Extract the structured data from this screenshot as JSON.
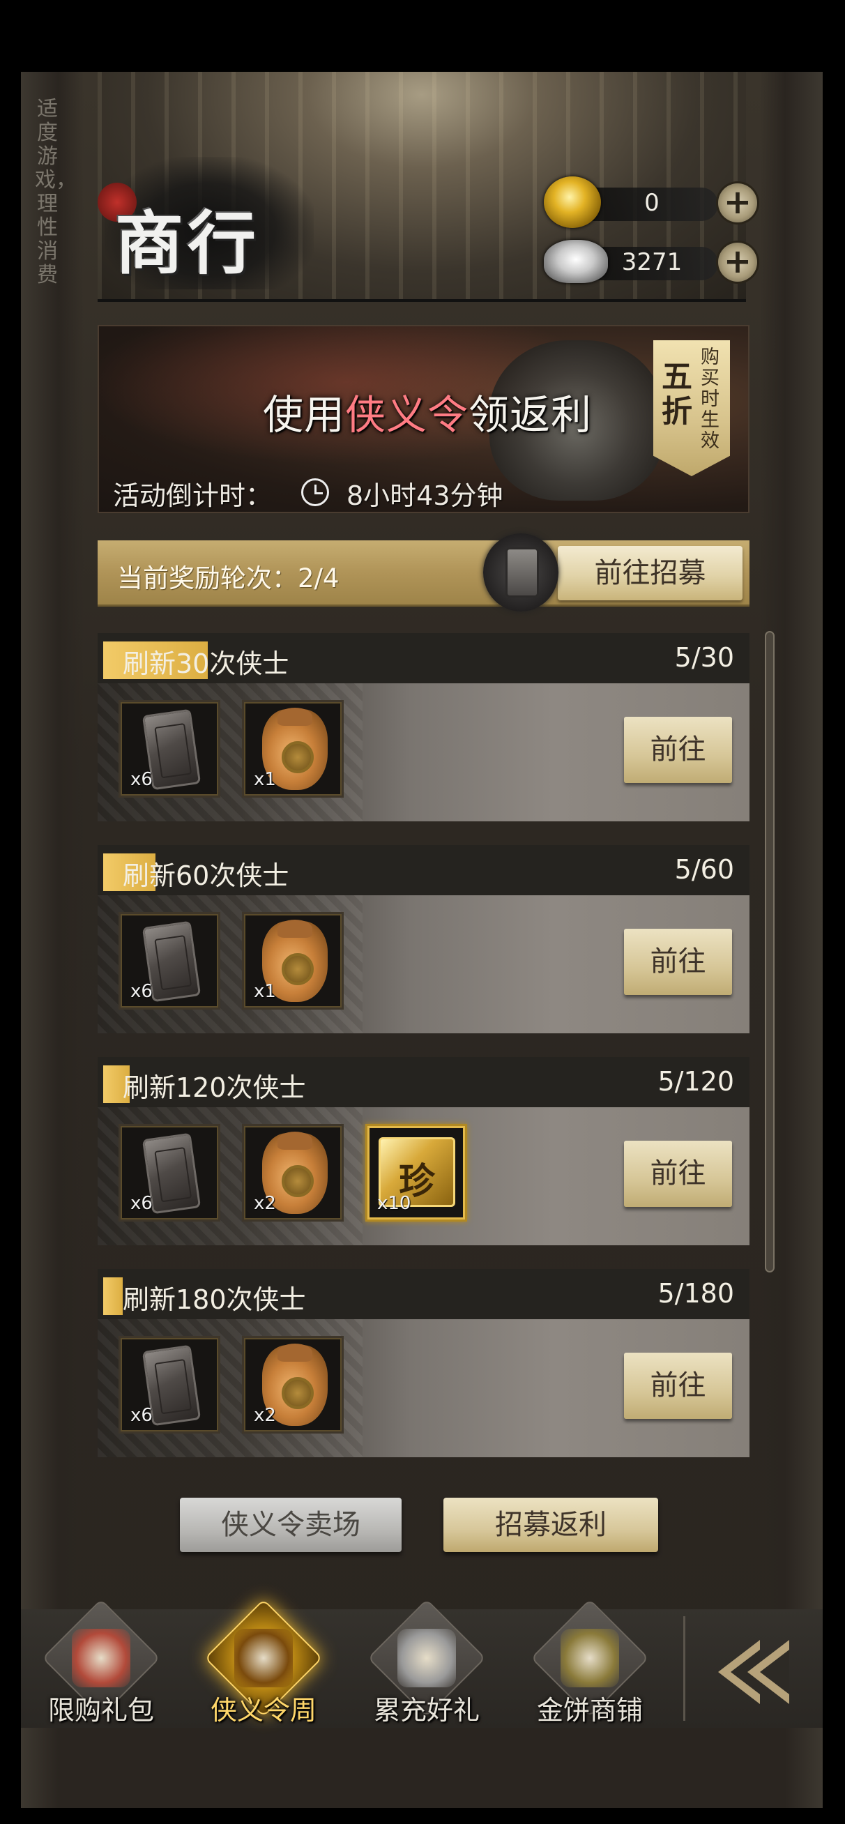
{
  "side_notice": "适度游戏，理性消费",
  "header": {
    "title": "商行",
    "currencies": [
      {
        "icon": "gold-coin-icon",
        "value": "0"
      },
      {
        "icon": "silver-ingot-icon",
        "value": "3271"
      }
    ]
  },
  "banner": {
    "title_pre": "使用",
    "title_highlight": "侠义令",
    "title_post": "领返利",
    "countdown_label": "活动倒计时：",
    "countdown_value": "8小时43分钟",
    "discount_big": "五折",
    "discount_small": "购买时生效"
  },
  "round": {
    "label": "当前奖励轮次：2/4",
    "button": "前往招募"
  },
  "tasks": [
    {
      "title": "刷新30次侠士",
      "progress": "5/30",
      "fraction": 0.1667,
      "items": [
        {
          "icon": "token-icon",
          "qty": "x6"
        },
        {
          "icon": "money-bag-icon",
          "qty": "x1"
        }
      ],
      "button": "前往"
    },
    {
      "title": "刷新60次侠士",
      "progress": "5/60",
      "fraction": 0.0833,
      "items": [
        {
          "icon": "token-icon",
          "qty": "x6"
        },
        {
          "icon": "money-bag-icon",
          "qty": "x1"
        }
      ],
      "button": "前往"
    },
    {
      "title": "刷新120次侠士",
      "progress": "5/120",
      "fraction": 0.0417,
      "items": [
        {
          "icon": "token-icon",
          "qty": "x6"
        },
        {
          "icon": "money-bag-icon",
          "qty": "x2"
        },
        {
          "icon": "treasure-gem-icon",
          "qty": "x10",
          "label": "珍"
        }
      ],
      "button": "前往"
    },
    {
      "title": "刷新180次侠士",
      "progress": "5/180",
      "fraction": 0.0278,
      "items": [
        {
          "icon": "token-icon",
          "qty": "x6"
        },
        {
          "icon": "money-bag-icon",
          "qty": "x2"
        }
      ],
      "button": "前往"
    }
  ],
  "bottom_buttons": {
    "market": "侠义令卖场",
    "recruit": "招募返利"
  },
  "nav": [
    {
      "label": "限购礼包",
      "icon": "gift-box-icon",
      "active": false
    },
    {
      "label": "侠义令周",
      "icon": "token-week-icon",
      "active": true
    },
    {
      "label": "累充好礼",
      "icon": "silver-pile-icon",
      "active": false
    },
    {
      "label": "金饼商铺",
      "icon": "gold-cakes-icon",
      "active": false
    }
  ]
}
